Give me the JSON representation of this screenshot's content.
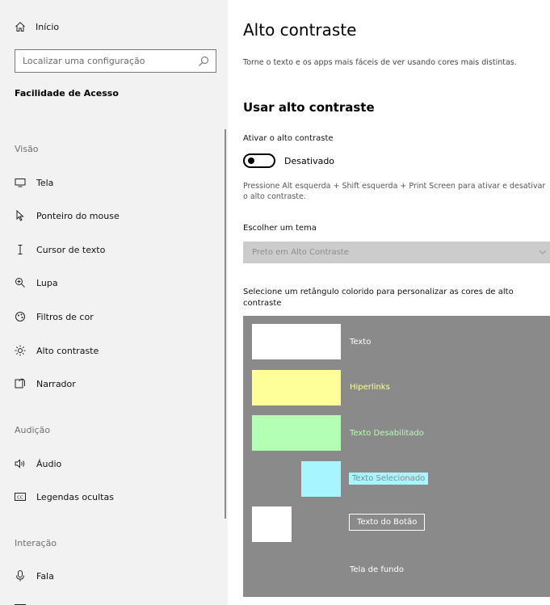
{
  "sidebar": {
    "home_label": "Início",
    "search_placeholder": "Localizar uma configuração",
    "section_title": "Facilidade de Acesso",
    "groups": {
      "vision": "Visão",
      "hearing": "Audição",
      "interaction": "Interação"
    },
    "items": [
      {
        "label": "Tela",
        "icon": "monitor-icon"
      },
      {
        "label": "Ponteiro do mouse",
        "icon": "mouse-pointer-icon"
      },
      {
        "label": "Cursor de texto",
        "icon": "text-cursor-icon"
      },
      {
        "label": "Lupa",
        "icon": "magnifier-icon"
      },
      {
        "label": "Filtros de cor",
        "icon": "color-filter-icon"
      },
      {
        "label": "Alto contraste",
        "icon": "brightness-icon"
      },
      {
        "label": "Narrador",
        "icon": "narrator-icon"
      },
      {
        "label": "Áudio",
        "icon": "speaker-icon"
      },
      {
        "label": "Legendas ocultas",
        "icon": "closed-captions-icon"
      },
      {
        "label": "Fala",
        "icon": "microphone-icon"
      }
    ]
  },
  "main": {
    "title": "Alto contraste",
    "subtitle": "Torne o texto e os apps mais fáceis de ver usando cores mais distintas.",
    "section_heading": "Usar alto contraste",
    "toggle_label": "Ativar o alto contraste",
    "toggle_state": "Desativado",
    "toggle_on": false,
    "shortcut_hint": "Pressione Alt esquerda + Shift esquerda + Print Screen para ativar e desativar o alto contraste.",
    "theme_label": "Escolher um tema",
    "theme_value": "Preto em Alto Contraste",
    "palette_desc": "Selecione um retângulo colorido para personalizar as cores de alto contraste",
    "palette": {
      "background_color": "#8a8a8a",
      "text": {
        "label": "Texto",
        "color": "#ffffff"
      },
      "hyperlinks": {
        "label": "Hiperlinks",
        "color": "#ffff99"
      },
      "disabled": {
        "label": "Texto Desabilitado",
        "color": "#b3ffb3"
      },
      "selected": {
        "label": "Texto Selecionado",
        "color": "#a6f5ff"
      },
      "button": {
        "label": "Texto do Botão",
        "color": "#ffffff"
      },
      "background_label": "Tela de fundo"
    }
  }
}
